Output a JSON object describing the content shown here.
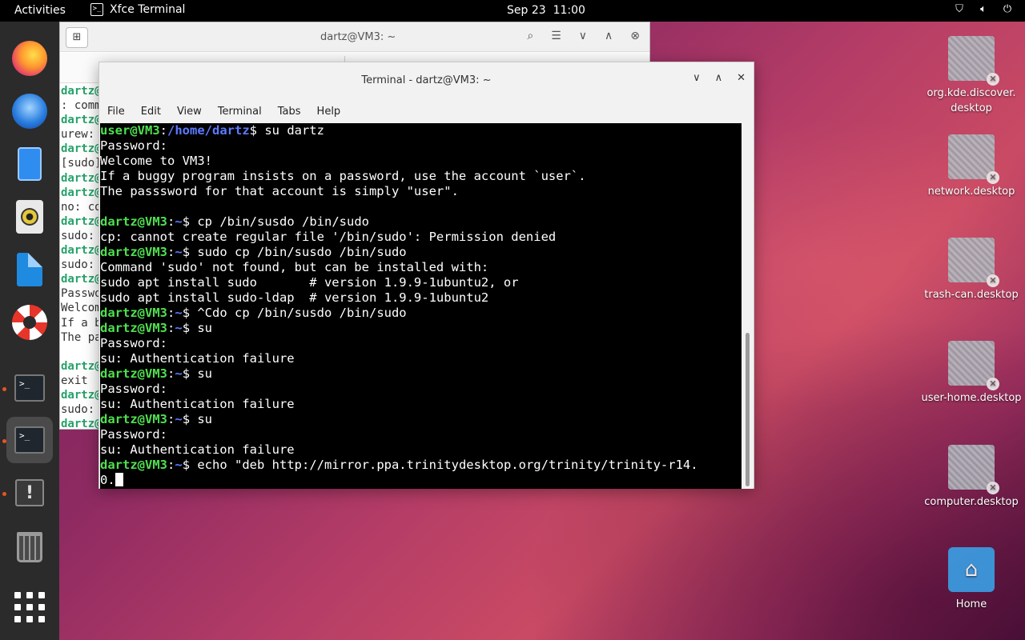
{
  "topbar": {
    "activities": "Activities",
    "app_name": "Xfce Terminal",
    "date": "Sep 23",
    "time": "11:00"
  },
  "dock": {
    "items": [
      "firefox",
      "thunderbird",
      "files",
      "rhythmbox",
      "libreoffice-writer",
      "help",
      "terminal",
      "xfce-terminal",
      "software-updater",
      "trash",
      "show-applications"
    ]
  },
  "desktop_icons": [
    {
      "label": "org.kde.discover.\ndesktop"
    },
    {
      "label": "network.desktop"
    },
    {
      "label": "trash-can.desktop"
    },
    {
      "label": "user-home.desktop"
    },
    {
      "label": "computer.desktop"
    },
    {
      "label": "Home"
    }
  ],
  "back_window": {
    "title": "dartz@VM3: ~",
    "lines": [
      "dartz@",
      ": comm",
      "dartz@",
      "urew: ",
      "dartz@",
      "[sudo]",
      "dartz@",
      "dartz@",
      "no: co",
      "dartz@",
      "sudo: ",
      "dartz@",
      "sudo: ",
      "dartz@",
      "Passwo",
      "Welcom",
      "If a b",
      "The pa",
      "",
      "dartz@",
      "exit",
      "dartz@",
      "sudo: ",
      "dartz@"
    ]
  },
  "front_window": {
    "title": "Terminal - dartz@VM3: ~",
    "menu": [
      "File",
      "Edit",
      "View",
      "Terminal",
      "Tabs",
      "Help"
    ],
    "terminal": {
      "first_prompt_user": "user@VM3",
      "first_prompt_path": "/home/dartz",
      "first_cmd": "$ su dartz",
      "line_password": "Password:",
      "line_welcome": "Welcome to VM3!",
      "line_buggy": "If a buggy program insists on a password, use the account `user`.",
      "line_pw_user": "The passsword for that account is simply \"user\".",
      "prompt_user": "dartz@VM3",
      "prompt_path": "~",
      "cmd1": "$ cp /bin/susdo /bin/sudo",
      "out1": "cp: cannot create regular file '/bin/sudo': Permission denied",
      "cmd2": "$ sudo cp /bin/susdo /bin/sudo",
      "out2a": "Command 'sudo' not found, but can be installed with:",
      "out2b": "sudo apt install sudo       # version 1.9.9-1ubuntu2, or",
      "out2c": "sudo apt install sudo-ldap  # version 1.9.9-1ubuntu2",
      "cmd3": "$ ^Cdo cp /bin/susdo /bin/sudo",
      "cmd_su": "$ su",
      "auth_fail": "su: Authentication failure",
      "cmd_echo": "$ echo \"deb http://mirror.ppa.trinitydesktop.org/trinity/trinity-r14.",
      "echo_cont": "0."
    }
  }
}
